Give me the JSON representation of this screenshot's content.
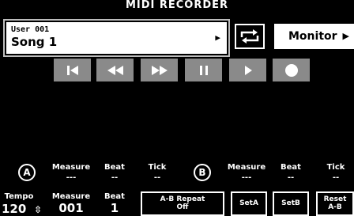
{
  "window": {
    "title": "MIDI RECORDER"
  },
  "song": {
    "user": "User 001",
    "name": "Song 1",
    "arrow": "▶"
  },
  "monitor": {
    "label": "Monitor",
    "arrow": "▶"
  },
  "transport": [
    "skip-to-start-icon",
    "rewind-icon",
    "fast-forward-icon",
    "pause-icon",
    "play-icon",
    "record-icon"
  ],
  "marker_a": {
    "badge": "A",
    "measure_label": "Measure",
    "measure_value": "---",
    "beat_label": "Beat",
    "beat_value": "--",
    "tick_label": "Tick",
    "tick_value": "--"
  },
  "marker_b": {
    "badge": "B",
    "measure_label": "Measure",
    "measure_value": "---",
    "beat_label": "Beat",
    "beat_value": "--",
    "tick_label": "Tick",
    "tick_value": "--"
  },
  "tempo": {
    "label": "Tempo",
    "value": "120",
    "stepper": "⇳"
  },
  "position": {
    "measure_label": "Measure",
    "measure_value": "001",
    "beat_label": "Beat",
    "beat_value": "1"
  },
  "ab_repeat": {
    "label": "A-B Repeat",
    "state": "Off"
  },
  "set_a": {
    "label": "SetA"
  },
  "set_b": {
    "label": "SetB"
  },
  "reset_ab": {
    "line1": "Reset",
    "line2": "A-B"
  }
}
